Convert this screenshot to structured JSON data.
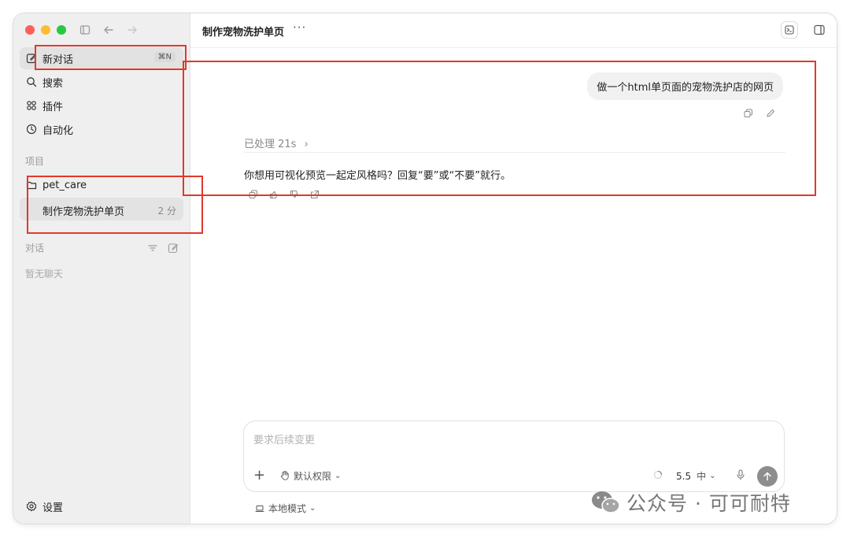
{
  "sidebar": {
    "nav": [
      {
        "label": "新对话",
        "icon": "new-chat-icon",
        "shortcut": "⌘N",
        "active": true
      },
      {
        "label": "搜索",
        "icon": "search-icon"
      },
      {
        "label": "插件",
        "icon": "plugins-icon"
      },
      {
        "label": "自动化",
        "icon": "clock-icon"
      }
    ],
    "projects_label": "项目",
    "project": {
      "name": "pet_care",
      "icon": "folder-icon"
    },
    "thread": {
      "title": "制作宠物洗护单页",
      "time": "2 分"
    },
    "chats_label": "对话",
    "empty_chats": "暂无聊天",
    "settings_label": "设置"
  },
  "header": {
    "title": "制作宠物洗护单页",
    "more": "···"
  },
  "conversation": {
    "user_message": "做一个html单页面的宠物洗护店的网页",
    "processed": "已处理 21s",
    "assistant_reply": "你想用可视化预览一起定风格吗？回复“要”或“不要”就行。"
  },
  "composer": {
    "placeholder": "要求后续变更",
    "permission": "默认权限",
    "model": "5.5",
    "reasoning": "中"
  },
  "footer": {
    "mode": "本地模式"
  },
  "watermark": "公众号 · 可可耐特",
  "colors": {
    "annotation_red": "#e0392d",
    "close": "#fe5f57",
    "minimize": "#febc2e",
    "zoom": "#28c840"
  }
}
